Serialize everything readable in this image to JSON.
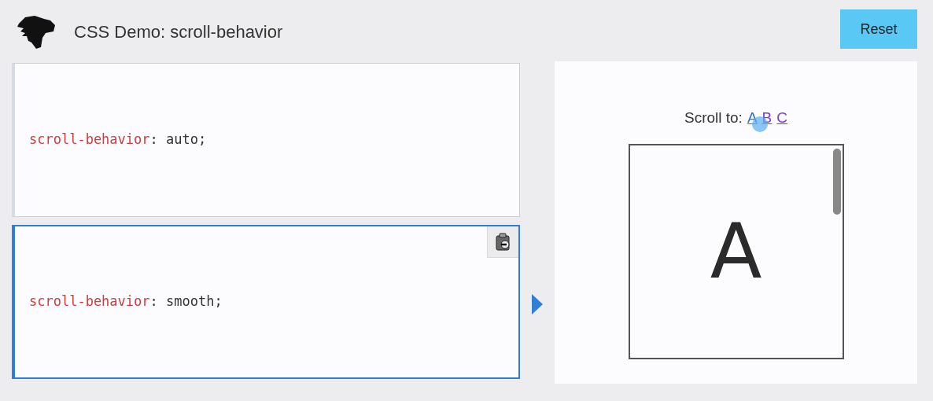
{
  "header": {
    "title": "CSS Demo: scroll-behavior",
    "reset_button": "Reset"
  },
  "examples": [
    {
      "property": "scroll-behavior",
      "colon": ":",
      "value": "auto",
      "semicolon": ";",
      "selected": false
    },
    {
      "property": "scroll-behavior",
      "colon": ":",
      "value": "smooth",
      "semicolon": ";",
      "selected": true
    }
  ],
  "output": {
    "label": "Scroll to:",
    "links": [
      {
        "text": "A",
        "visited": false
      },
      {
        "text": "B",
        "visited": true
      },
      {
        "text": "C",
        "visited": true
      }
    ],
    "box_text": "A"
  }
}
